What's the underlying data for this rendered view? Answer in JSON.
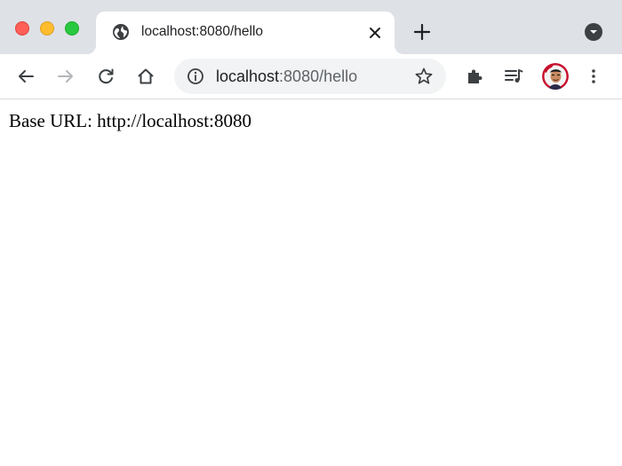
{
  "browser": {
    "tab": {
      "title": "localhost:8080/hello",
      "favicon": "globe-icon"
    },
    "omnibox": {
      "host": "localhost",
      "path": ":8080/hello",
      "info_icon": "info-icon",
      "star_icon": "star-icon"
    },
    "toolbar_icons": [
      "back-arrow-icon",
      "forward-arrow-icon",
      "reload-icon",
      "home-icon",
      "extensions-icon",
      "media-queue-icon",
      "profile-avatar",
      "more-vert-icon"
    ],
    "colors": {
      "tabstrip_bg": "#dee1e6",
      "omnibox_bg": "#f1f3f4",
      "traffic_close": "#ff5f57",
      "traffic_minimize": "#febc2e",
      "traffic_maximize": "#28c840"
    }
  },
  "page": {
    "text": "Base URL: http://localhost:8080"
  }
}
